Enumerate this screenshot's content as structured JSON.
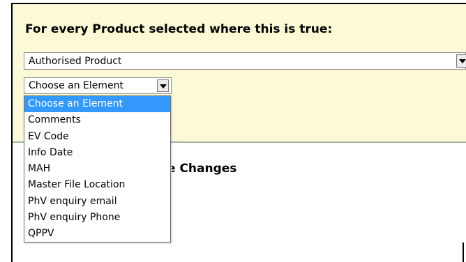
{
  "form": {
    "heading": "For every Product selected where this is true:",
    "product_select": {
      "value": "Authorised Product"
    },
    "element_select": {
      "value": "Choose an Element"
    }
  },
  "dropdown": {
    "options": [
      "Choose an Element",
      "Comments",
      "EV Code",
      "Info Date",
      "MAH",
      "Master File Location",
      "PhV enquiry email",
      "PhV enquiry Phone",
      "QPPV"
    ],
    "selected_index": 0
  },
  "section": {
    "partial_title": "e Changes"
  },
  "colors": {
    "panel_background": "#fcf9d6",
    "selection_highlight": "#3399ff",
    "panel_divider": "#a7b4a3"
  },
  "icons": [
    "chevron-down-icon"
  ]
}
